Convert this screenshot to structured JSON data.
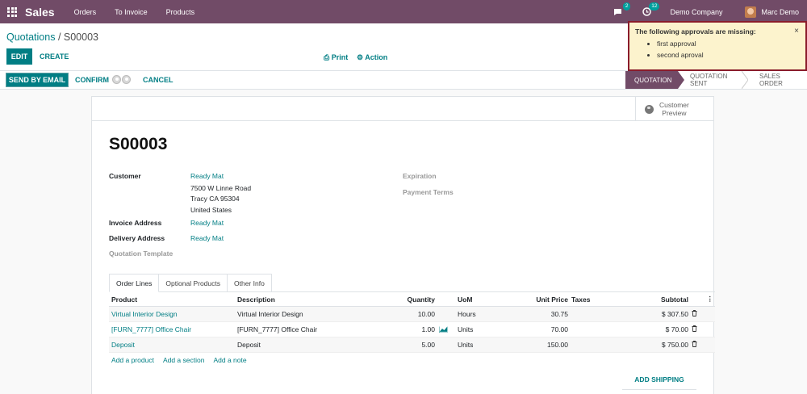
{
  "navbar": {
    "app_name": "Sales",
    "menu": [
      "Orders",
      "To Invoice",
      "Products"
    ],
    "messages_count": "2",
    "activities_count": "12",
    "company": "Demo Company",
    "user": "Marc Demo",
    "color": "#714b67"
  },
  "control": {
    "breadcrumb_parent": "Quotations",
    "breadcrumb_sep": " / ",
    "breadcrumb_current": "S00003",
    "edit_label": "EDIT",
    "create_label": "CREATE",
    "print_label": "Print",
    "action_label": "Action"
  },
  "statusbar": {
    "send_email_label": "SEND BY EMAIL",
    "confirm_label": "CONFIRM",
    "cancel_label": "CANCEL",
    "stages": [
      "QUOTATION",
      "QUOTATION SENT",
      "SALES ORDER"
    ],
    "active_stage": "QUOTATION"
  },
  "notification": {
    "title": "The following approvals are missing:",
    "items": [
      "first approval",
      "second aproval"
    ],
    "close": "×"
  },
  "sheet": {
    "preview_label_1": "Customer",
    "preview_label_2": "Preview",
    "title": "S00003",
    "customer_label": "Customer",
    "customer_name": "Ready Mat",
    "address_line1": "7500 W Linne Road",
    "address_line2": "Tracy CA 95304",
    "address_line3": "United States",
    "invoice_address_label": "Invoice Address",
    "invoice_address": "Ready Mat",
    "delivery_address_label": "Delivery Address",
    "delivery_address": "Ready Mat",
    "quotation_template_label": "Quotation Template",
    "expiration_label": "Expiration",
    "payment_terms_label": "Payment Terms"
  },
  "tabs": [
    "Order Lines",
    "Optional Products",
    "Other Info"
  ],
  "table": {
    "headers": {
      "product": "Product",
      "description": "Description",
      "quantity": "Quantity",
      "uom": "UoM",
      "unit_price": "Unit Price",
      "taxes": "Taxes",
      "subtotal": "Subtotal"
    },
    "rows": [
      {
        "product": "Virtual Interior Design",
        "description": "Virtual Interior Design",
        "quantity": "10.00",
        "uom": "Hours",
        "unit_price": "30.75",
        "taxes": "",
        "subtotal": "$ 307.50"
      },
      {
        "product": "[FURN_7777] Office Chair",
        "description": "[FURN_7777] Office Chair",
        "quantity": "1.00",
        "uom": "Units",
        "unit_price": "70.00",
        "taxes": "",
        "subtotal": "$ 70.00"
      },
      {
        "product": "Deposit",
        "description": "Deposit",
        "quantity": "5.00",
        "uom": "Units",
        "unit_price": "150.00",
        "taxes": "",
        "subtotal": "$ 750.00"
      }
    ],
    "add_product": "Add a product",
    "add_section": "Add a section",
    "add_note": "Add a note",
    "add_shipping": "ADD SHIPPING"
  }
}
